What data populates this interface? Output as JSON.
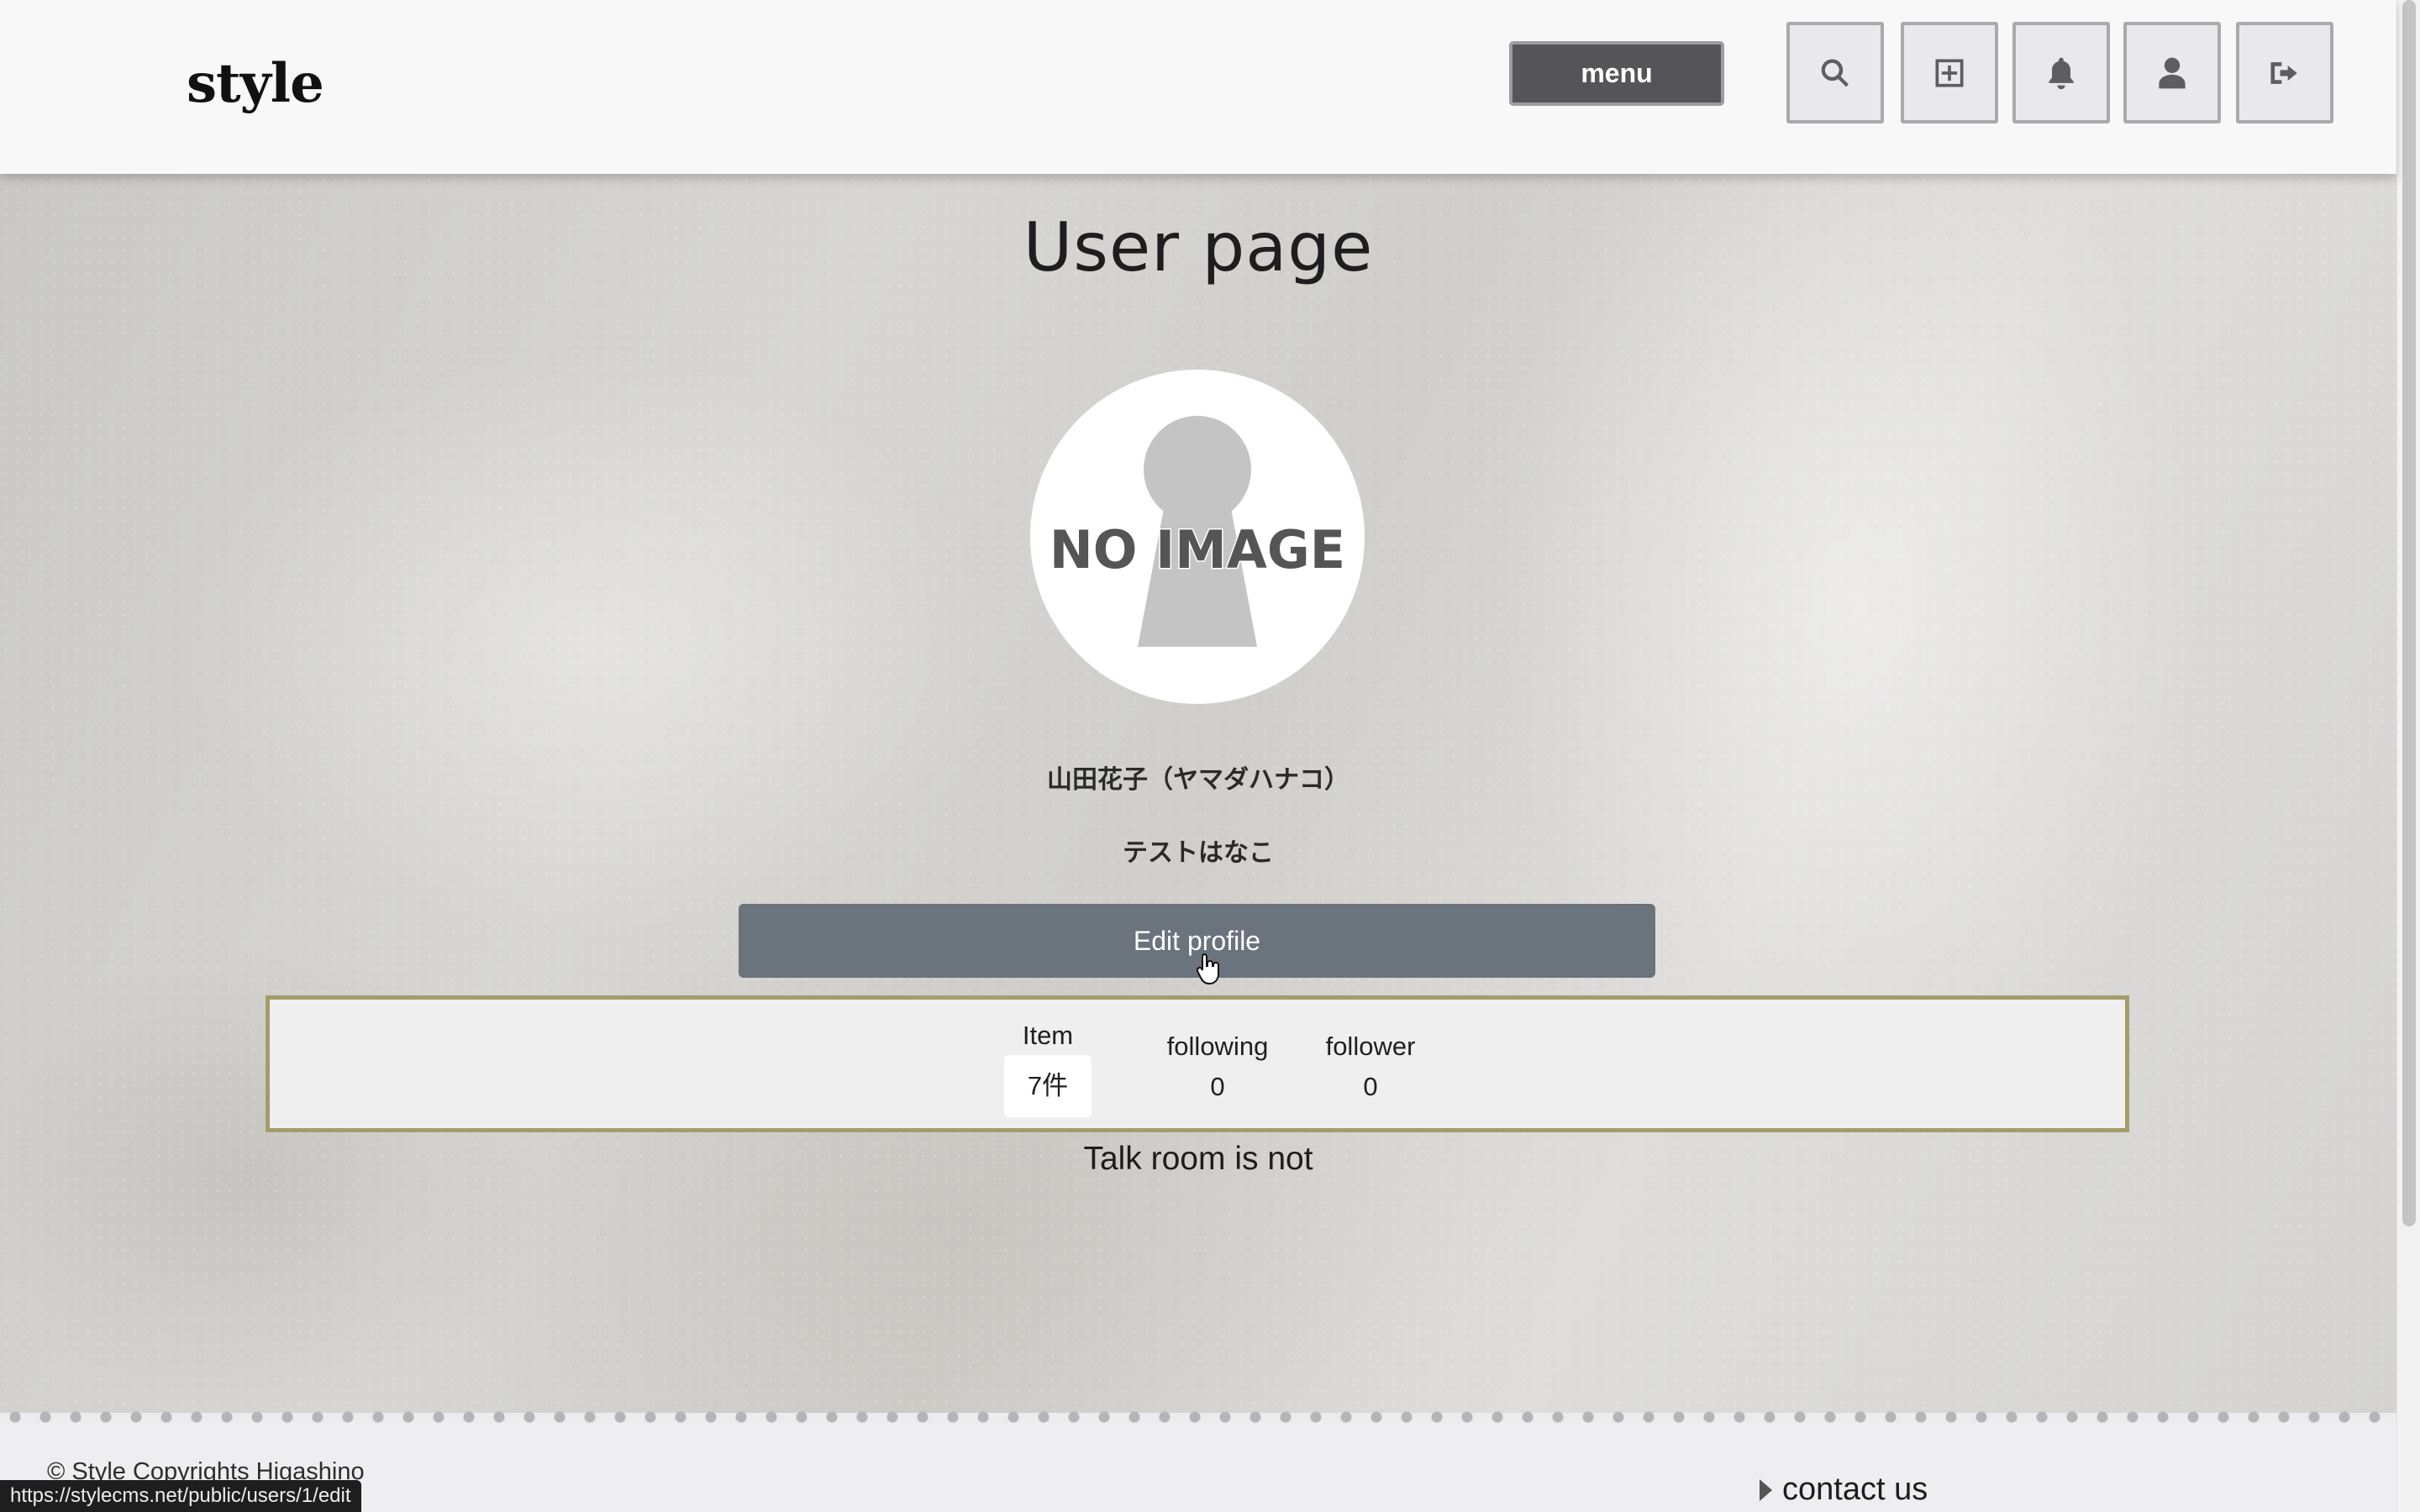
{
  "header": {
    "logo": "style",
    "menu_label": "menu",
    "icons": [
      "search-icon",
      "add-icon",
      "bell-icon",
      "user-icon",
      "sign-out-icon"
    ]
  },
  "main": {
    "title": "User page",
    "avatar_text": "NO IMAGE",
    "full_name": "山田花子（ヤマダハナコ）",
    "nickname": "テストはなこ",
    "edit_label": "Edit profile",
    "stats": {
      "item": {
        "label": "Item",
        "value": "7件"
      },
      "following": {
        "label": "following",
        "value": "0"
      },
      "follower": {
        "label": "follower",
        "value": "0"
      }
    },
    "talk_room": "Talk room is not"
  },
  "footer": {
    "copyright": "© Style Copyrights Higashino",
    "contact": "contact us"
  },
  "status_bar": {
    "url": "https://stylecms.net/public/users/1/edit"
  },
  "colors": {
    "menu_bg": "#555559",
    "edit_button": "#6b737c",
    "stats_border": "#a39d6b"
  }
}
